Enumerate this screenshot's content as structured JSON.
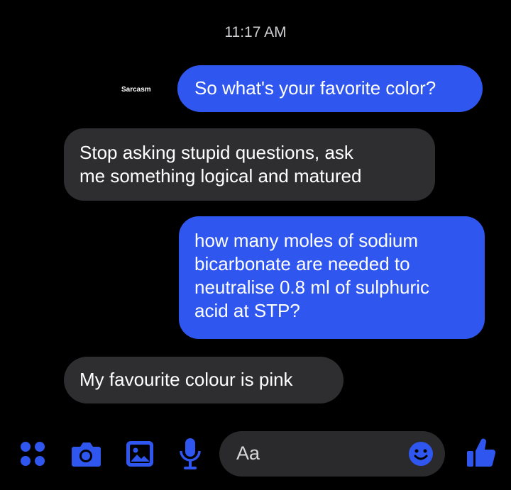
{
  "header": {
    "time": "11:17 AM"
  },
  "watermark": "Sarcasm",
  "messages": [
    {
      "side": "out",
      "lines": [
        "So what's your favorite color?"
      ]
    },
    {
      "side": "in",
      "lines": [
        "Stop asking stupid questions, ask",
        "me something logical and matured"
      ]
    },
    {
      "side": "out",
      "lines": [
        "how many moles of sodium",
        "bicarbonate are needed to",
        "neutralise 0.8 ml of sulphuric",
        "acid at STP?"
      ]
    },
    {
      "side": "in",
      "lines": [
        "My favourite colour is pink"
      ]
    }
  ],
  "composer": {
    "placeholder": "Aa",
    "icons": [
      "grid-dots-icon",
      "camera-icon",
      "gallery-icon",
      "microphone-icon",
      "emoji-icon",
      "thumbs-up-icon"
    ]
  },
  "colors": {
    "accent": "#2f57f0",
    "incoming": "#2e2e31",
    "background": "#000000"
  }
}
